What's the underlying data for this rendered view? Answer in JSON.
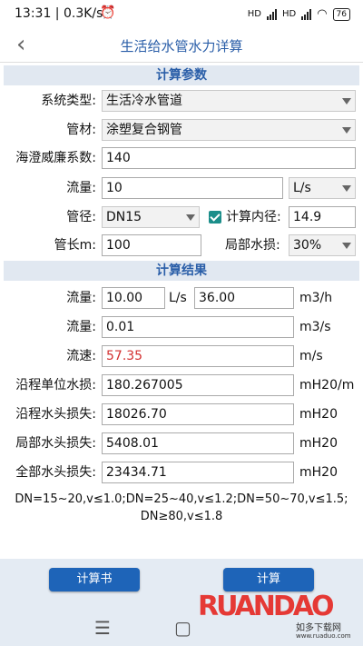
{
  "status": {
    "time_speed": "13:31 | 0.3K/s",
    "alarm_icon": "alarm-clock-icon",
    "net_label1": "HD",
    "net_label2": "HD",
    "battery": "76"
  },
  "header": {
    "title": "生活给水管水力详算",
    "back_icon": "chevron-left-icon"
  },
  "calc_params": {
    "section_title": "计算参数",
    "system_type_label": "系统类型:",
    "system_type_value": "生活冷水管道",
    "material_label": "管材:",
    "material_value": "涂塑复合钢管",
    "hw_coef_label": "海澄威廉系数:",
    "hw_coef_value": "140",
    "flow_label": "流量:",
    "flow_value": "10",
    "flow_unit_value": "L/s",
    "diameter_label": "管径:",
    "diameter_value": "DN15",
    "calc_inner_diam_label": "计算内径:",
    "calc_inner_diam_checked": true,
    "inner_diam_value": "14.9",
    "pipe_length_label": "管长m:",
    "pipe_length_value": "100",
    "local_loss_label": "局部水损:",
    "local_loss_value": "30%"
  },
  "results": {
    "section_title": "计算结果",
    "flow1_label": "流量:",
    "flow1_value": "10.00",
    "flow1_unit": "L/s",
    "flow1_m3h_value": "36.00",
    "flow1_m3h_unit": "m3/h",
    "flow2_label": "流量:",
    "flow2_value": "0.01",
    "flow2_unit": "m3/s",
    "velocity_label": "流速:",
    "velocity_value": "57.35",
    "velocity_unit": "m/s",
    "unit_loss_label": "沿程单位水损:",
    "unit_loss_value": "180.267005",
    "unit_loss_unit": "mH20/m",
    "head_loss_label": "沿程水头损失:",
    "head_loss_value": "18026.70",
    "head_loss_unit": "mH20",
    "local_head_loss_label": "局部水头损失:",
    "local_head_loss_value": "5408.01",
    "local_head_loss_unit": "mH20",
    "total_head_loss_label": "全部水头损失:",
    "total_head_loss_value": "23434.71",
    "total_head_loss_unit": "mH20",
    "note_line1": "DN=15~20,v≤1.0;DN=25~40,v≤1.2;DN=50~70,v≤1.5;",
    "note_line2": "DN≥80,v≤1.8"
  },
  "bottom": {
    "calc_book_button": "计算书",
    "calc_button": "计算"
  },
  "colors": {
    "accent": "#2a5ea8",
    "section_bg": "#e1e8f1",
    "warning_value": "#d32f2f",
    "button": "#1e64b8"
  },
  "watermark": {
    "brand": "RUANDAO",
    "cn": "如多下载网",
    "url": "www.ruaduo.com"
  }
}
